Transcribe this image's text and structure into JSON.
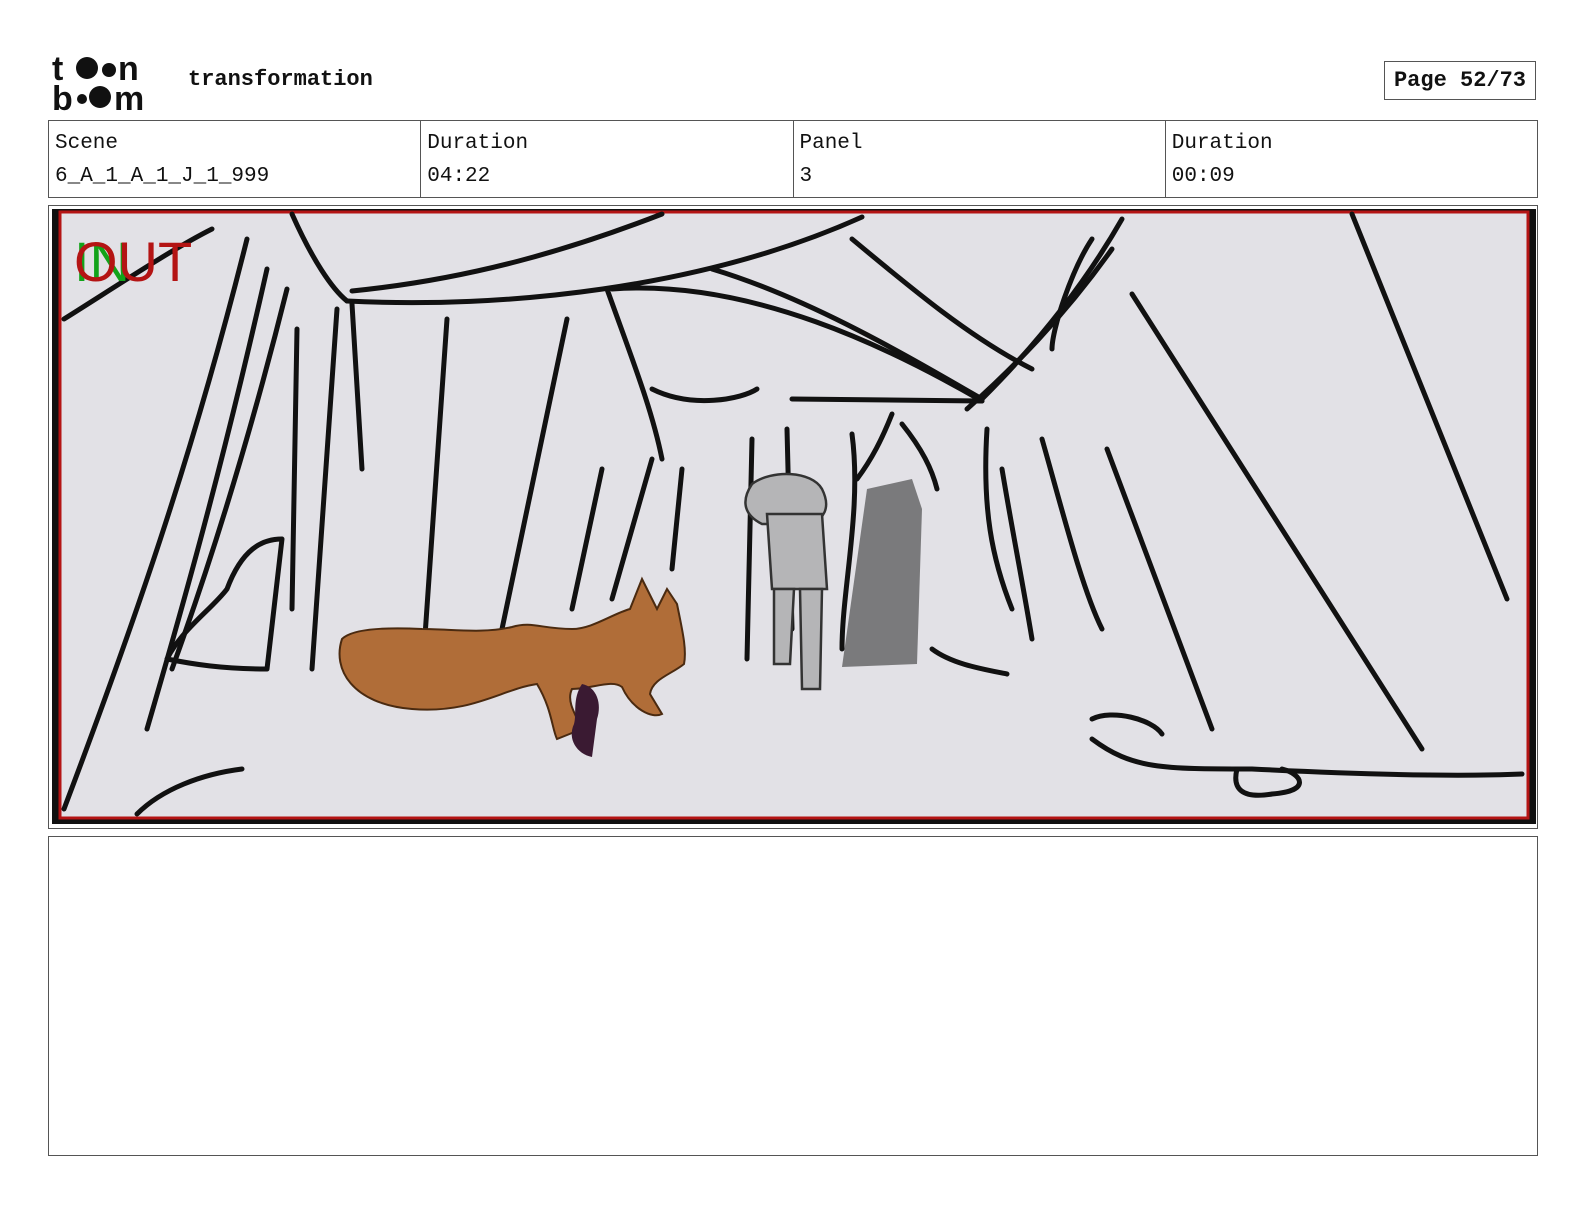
{
  "header": {
    "logo_text": "toon boom",
    "project_title": "transformation",
    "page_label": "Page 52/73"
  },
  "info": {
    "scene_label": "Scene",
    "scene_value": "6_A_1_A_1_J_1_999",
    "duration_label": "Duration",
    "duration_value": "04:22",
    "panel_label": "Panel",
    "panel_value": "3",
    "panel_duration_label": "Duration",
    "panel_duration_value": "00:09"
  },
  "panel": {
    "in_marker": "IN",
    "out_marker": "OUT",
    "description": ""
  },
  "notes": {
    "text": ""
  },
  "colors": {
    "frame_red": "#b41414",
    "in_green": "#12a31a",
    "canvas": "#e2e1e6",
    "fox": "#b06d38"
  }
}
